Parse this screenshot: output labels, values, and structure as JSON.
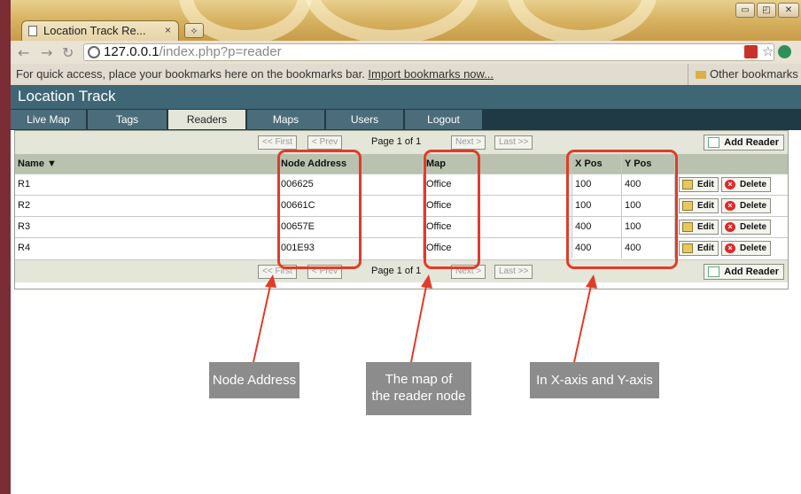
{
  "browser": {
    "tab_title": "Location Track  Re...",
    "tab_close": "×",
    "new_tab": "⟡",
    "window_controls": [
      "▭",
      "◰",
      "✕"
    ],
    "url_host": "127.0.0.1",
    "url_path": "/index.php?p=reader",
    "bookmarks_text": "For quick access, place your bookmarks here on the bookmarks bar.",
    "bookmarks_link": "Import bookmarks now...",
    "other_bookmarks": "Other bookmarks"
  },
  "app": {
    "title": "Location Track",
    "nav": [
      "Live Map",
      "Tags",
      "Readers",
      "Maps",
      "Users",
      "Logout"
    ],
    "active_nav": "Readers"
  },
  "grid": {
    "pager": {
      "first": "<< First",
      "prev": "< Prev",
      "page_info": "Page 1 of 1",
      "next": "Next >",
      "last": "Last >>"
    },
    "add_button": "Add Reader",
    "columns": [
      "Name ▼",
      "Node Address",
      "Map",
      "X Pos",
      "Y Pos"
    ],
    "rows": [
      {
        "name": "R1",
        "node": "006625",
        "map": "Office",
        "x": "100",
        "y": "400"
      },
      {
        "name": "R2",
        "node": "00661C",
        "map": "Office",
        "x": "100",
        "y": "100"
      },
      {
        "name": "R3",
        "node": "00657E",
        "map": "Office",
        "x": "400",
        "y": "100"
      },
      {
        "name": "R4",
        "node": "001E93",
        "map": "Office",
        "x": "400",
        "y": "400"
      }
    ],
    "edit_label": "Edit",
    "delete_label": "Delete"
  },
  "annotations": {
    "node_address": "Node Address",
    "map_line1": "The map of",
    "map_line2": "the reader node",
    "xy": "In X-axis and Y-axis",
    "highlight_color": "#e03c2a",
    "callout_color": "#8c8c8c"
  }
}
